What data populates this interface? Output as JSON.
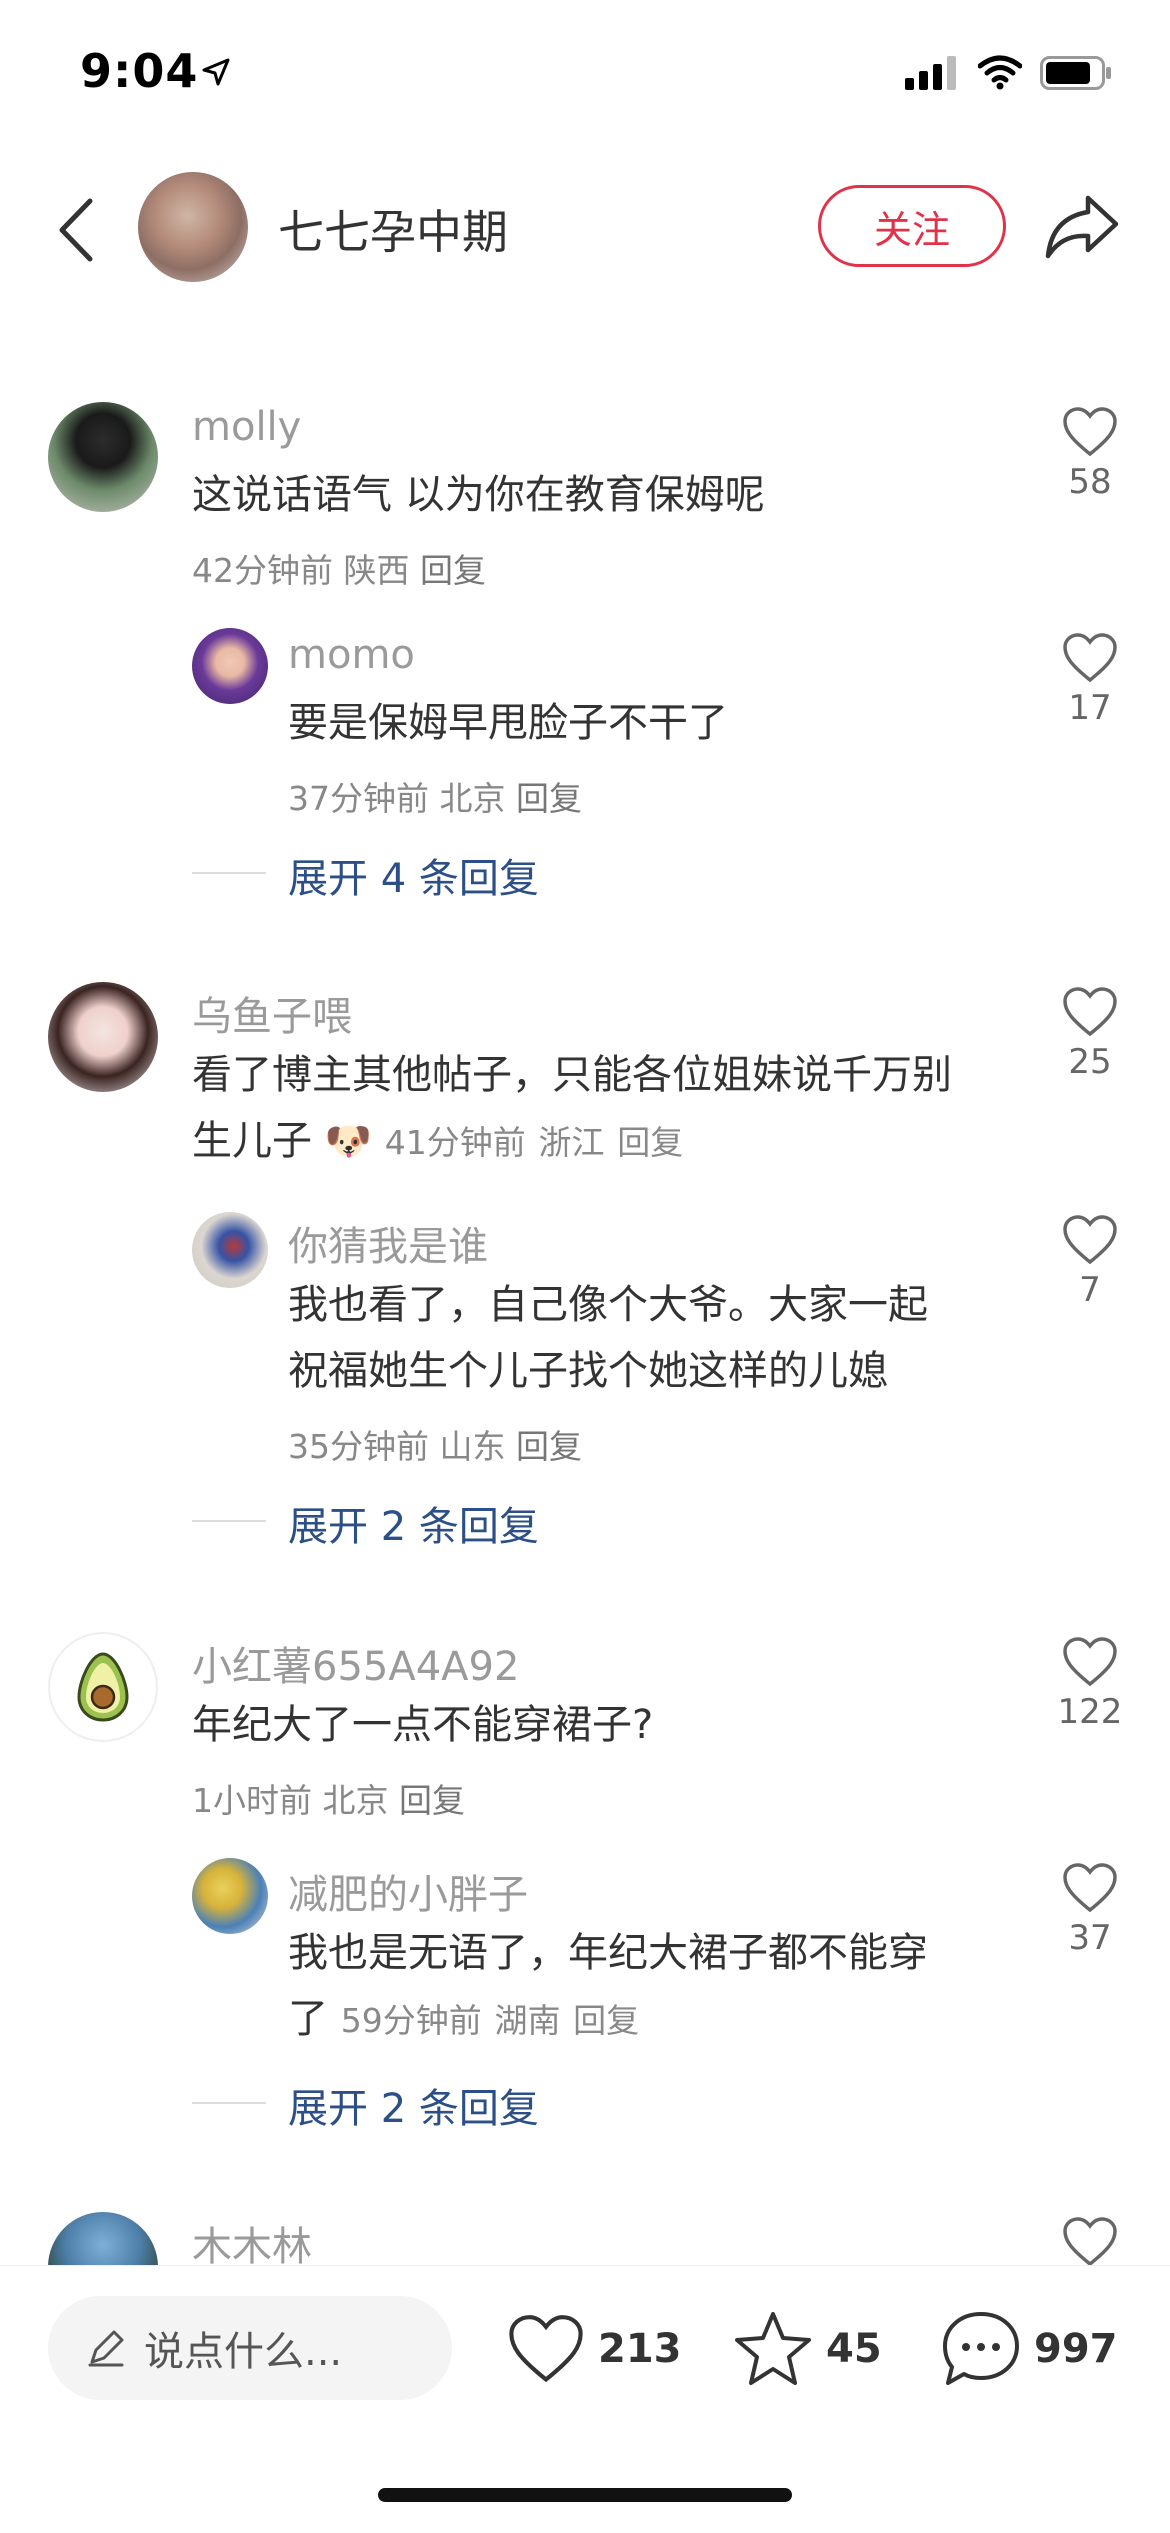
{
  "status_bar": {
    "time": "9:04"
  },
  "header": {
    "author_name": "七七孕中期",
    "follow_label": "关注"
  },
  "comments": [
    {
      "username": "molly",
      "text": "这说话语气 以为你在教育保姆呢",
      "time": "42分钟前",
      "location": "陕西",
      "reply_label": "回复",
      "likes": "58",
      "replies": [
        {
          "username": "momo",
          "text": "要是保姆早甩脸子不干了",
          "time": "37分钟前",
          "location": "北京",
          "reply_label": "回复",
          "likes": "17"
        }
      ],
      "expand_label": "展开 4 条回复"
    },
    {
      "username": "乌鱼子喂",
      "text_line1": "看了博主其他帖子，只能各位姐妹说千万别",
      "text_line2": "生儿子",
      "emoji": "🐶",
      "time": "41分钟前",
      "location": "浙江",
      "reply_label": "回复",
      "likes": "25",
      "replies": [
        {
          "username": "你猜我是谁",
          "text_line1": "我也看了，自己像个大爷。大家一起",
          "text_line2": "祝福她生个儿子找个她这样的儿媳",
          "time": "35分钟前",
          "location": "山东",
          "reply_label": "回复",
          "likes": "7"
        }
      ],
      "expand_label": "展开 2 条回复"
    },
    {
      "username": "小红薯655A4A92",
      "text": "年纪大了一点不能穿裙子?",
      "time": "1小时前",
      "location": "北京",
      "reply_label": "回复",
      "likes": "122",
      "replies": [
        {
          "username": "减肥的小胖子",
          "text_line1": "我也是无语了，年纪大裙子都不能穿",
          "text_line2": "了",
          "time": "59分钟前",
          "location": "湖南",
          "reply_label": "回复",
          "likes": "37"
        }
      ],
      "expand_label": "展开 2 条回复"
    },
    {
      "username": "木木林"
    }
  ],
  "bottom_bar": {
    "input_placeholder": "说点什么...",
    "likes": "213",
    "stars": "45",
    "comments": "997"
  }
}
